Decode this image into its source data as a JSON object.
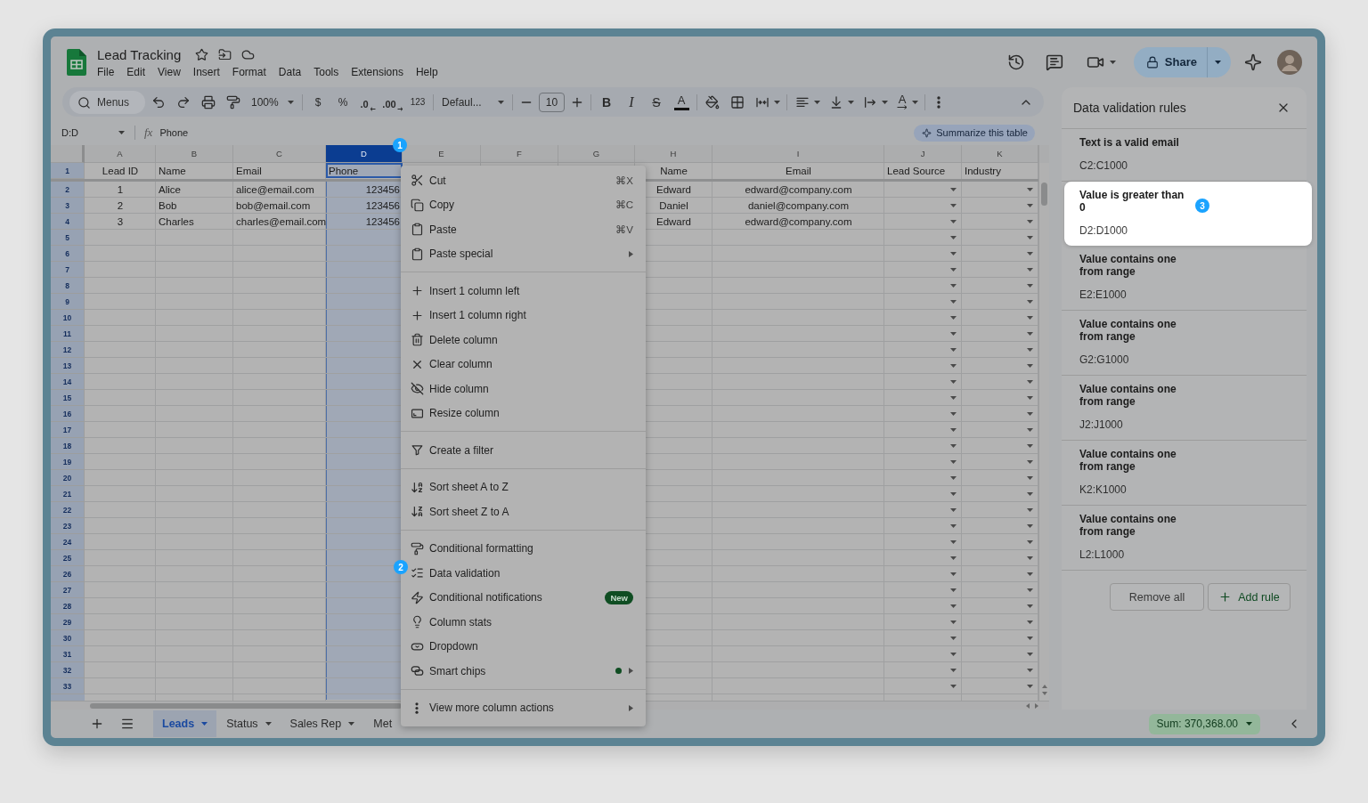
{
  "app": {
    "title": "Lead Tracking",
    "menus": [
      "File",
      "Edit",
      "View",
      "Insert",
      "Format",
      "Data",
      "Tools",
      "Extensions",
      "Help"
    ],
    "share": "Share"
  },
  "toolbar": [
    {
      "kind": "search",
      "placeholder": "Menus"
    },
    {
      "kind": "undo"
    },
    {
      "kind": "redo"
    },
    {
      "kind": "print"
    },
    {
      "kind": "paint_format"
    },
    {
      "kind": "zoom",
      "label": "100%"
    },
    {
      "kind": "divider"
    },
    {
      "kind": "currency",
      "label": "$"
    },
    {
      "kind": "percent",
      "label": "%"
    },
    {
      "kind": "decimal_less",
      "label": ".0"
    },
    {
      "kind": "decimal_more",
      "label": ".00"
    },
    {
      "kind": "number_format",
      "label": "123"
    },
    {
      "kind": "divider"
    },
    {
      "kind": "font",
      "label": "Defaul..."
    },
    {
      "kind": "divider"
    },
    {
      "kind": "minus"
    },
    {
      "kind": "field",
      "value": "10"
    },
    {
      "kind": "plus"
    },
    {
      "kind": "divider"
    },
    {
      "kind": "bold",
      "label": "B"
    },
    {
      "kind": "italic",
      "label": "I"
    },
    {
      "kind": "strike",
      "label": "S"
    },
    {
      "kind": "text_color",
      "label": "A"
    },
    {
      "kind": "divider"
    },
    {
      "kind": "fill"
    },
    {
      "kind": "borders"
    },
    {
      "kind": "merge"
    },
    {
      "kind": "divider"
    },
    {
      "kind": "align"
    },
    {
      "kind": "valign"
    },
    {
      "kind": "wrap"
    },
    {
      "kind": "rotate",
      "label": "A"
    },
    {
      "kind": "divider"
    },
    {
      "kind": "more"
    },
    {
      "kind": "collapse"
    }
  ],
  "formula_bar": {
    "name_box": "D:D",
    "fx": "fx",
    "formula": "Phone",
    "chip": "Summarize this table"
  },
  "grid": {
    "columns": [
      {
        "label": "A",
        "selected": false,
        "dropdown": false
      },
      {
        "label": "B",
        "selected": false,
        "dropdown": false
      },
      {
        "label": "C",
        "selected": false,
        "dropdown": false
      },
      {
        "label": "D",
        "selected": true,
        "dropdown": false,
        "callout": "1"
      },
      {
        "label": "E",
        "selected": false,
        "dropdown": false
      },
      {
        "label": "F",
        "selected": false,
        "dropdown": false
      },
      {
        "label": "G",
        "selected": false,
        "dropdown": false
      },
      {
        "label": "H",
        "selected": false,
        "dropdown": false
      },
      {
        "label": "I",
        "selected": false,
        "dropdown": false
      },
      {
        "label": "J",
        "selected": false,
        "dropdown": true
      },
      {
        "label": "K",
        "selected": false,
        "dropdown": true
      }
    ],
    "rows": [
      {
        "number": "1",
        "frozen": true,
        "cells": {
          "A": {
            "text": "Lead ID",
            "kind": "centered"
          },
          "B": {
            "text": "Name",
            "kind": "text"
          },
          "C": {
            "text": "Email",
            "kind": "text"
          },
          "D": {
            "text": "Phone",
            "kind": "text"
          },
          "H": {
            "text": "Name",
            "kind": "centered"
          },
          "I": {
            "text": "Email",
            "kind": "centered"
          },
          "J": {
            "text": "Lead Source",
            "kind": "text"
          },
          "K": {
            "text": "Industry",
            "kind": "text"
          }
        }
      },
      {
        "number": "2",
        "frozen": false,
        "cells": {
          "A": {
            "text": "1",
            "kind": "centered"
          },
          "B": {
            "text": "Alice",
            "kind": "text"
          },
          "C": {
            "text": "alice@email.com",
            "kind": "text"
          },
          "D": {
            "text": "123456",
            "kind": "number"
          },
          "H": {
            "text": "Edward",
            "kind": "centered"
          },
          "I": {
            "text": "edward@company.com",
            "kind": "centered"
          }
        }
      },
      {
        "number": "3",
        "frozen": false,
        "cells": {
          "A": {
            "text": "2",
            "kind": "centered"
          },
          "B": {
            "text": "Bob",
            "kind": "text"
          },
          "C": {
            "text": "bob@email.com",
            "kind": "text"
          },
          "D": {
            "text": "123456",
            "kind": "number"
          },
          "H": {
            "text": "Daniel",
            "kind": "centered"
          },
          "I": {
            "text": "daniel@company.com",
            "kind": "centered"
          }
        }
      },
      {
        "number": "4",
        "frozen": false,
        "cells": {
          "A": {
            "text": "3",
            "kind": "centered"
          },
          "B": {
            "text": "Charles",
            "kind": "text"
          },
          "C": {
            "text": "charles@email.com",
            "kind": "text"
          },
          "D": {
            "text": "123456",
            "kind": "number"
          },
          "H": {
            "text": "Edward",
            "kind": "centered"
          },
          "I": {
            "text": "edward@company.com",
            "kind": "centered"
          }
        }
      },
      {
        "number": "5",
        "frozen": false
      },
      {
        "number": "6",
        "frozen": false
      },
      {
        "number": "7",
        "frozen": false
      },
      {
        "number": "8",
        "frozen": false
      },
      {
        "number": "9",
        "frozen": false
      },
      {
        "number": "10",
        "frozen": false
      },
      {
        "number": "11",
        "frozen": false
      },
      {
        "number": "12",
        "frozen": false
      },
      {
        "number": "13",
        "frozen": false
      },
      {
        "number": "14",
        "frozen": false
      },
      {
        "number": "15",
        "frozen": false
      },
      {
        "number": "16",
        "frozen": false
      },
      {
        "number": "17",
        "frozen": false
      },
      {
        "number": "18",
        "frozen": false
      },
      {
        "number": "19",
        "frozen": false
      },
      {
        "number": "20",
        "frozen": false
      },
      {
        "number": "21",
        "frozen": false
      },
      {
        "number": "22",
        "frozen": false
      },
      {
        "number": "23",
        "frozen": false
      },
      {
        "number": "24",
        "frozen": false
      },
      {
        "number": "25",
        "frozen": false
      },
      {
        "number": "26",
        "frozen": false
      },
      {
        "number": "27",
        "frozen": false
      },
      {
        "number": "28",
        "frozen": false
      },
      {
        "number": "29",
        "frozen": false
      },
      {
        "number": "30",
        "frozen": false
      },
      {
        "number": "31",
        "frozen": false
      },
      {
        "number": "32",
        "frozen": false
      },
      {
        "number": "33",
        "frozen": false
      }
    ]
  },
  "context_menu": {
    "groups": [
      [
        {
          "kind": "cut",
          "label": "Cut",
          "shortcut": "⌘X",
          "submenu": false,
          "dot": false
        },
        {
          "kind": "copy",
          "label": "Copy",
          "shortcut": "⌘C",
          "submenu": false,
          "dot": false
        },
        {
          "kind": "paste",
          "label": "Paste",
          "shortcut": "⌘V",
          "submenu": false,
          "dot": false
        },
        {
          "kind": "paste_special",
          "label": "Paste special",
          "submenu": true,
          "dot": false
        }
      ],
      [
        {
          "kind": "insert_left",
          "label": "Insert 1 column left",
          "submenu": false,
          "dot": false
        },
        {
          "kind": "insert_right",
          "label": "Insert 1 column right",
          "submenu": false,
          "dot": false
        },
        {
          "kind": "delete",
          "label": "Delete column",
          "submenu": false,
          "dot": false
        },
        {
          "kind": "clear",
          "label": "Clear column",
          "submenu": false,
          "dot": false
        },
        {
          "kind": "hide",
          "label": "Hide column",
          "submenu": false,
          "dot": false
        },
        {
          "kind": "resize",
          "label": "Resize column",
          "submenu": false,
          "dot": false
        }
      ],
      [
        {
          "kind": "filter",
          "label": "Create a filter",
          "submenu": false,
          "dot": false
        }
      ],
      [
        {
          "kind": "sort_asc",
          "label": "Sort sheet A to Z",
          "submenu": false,
          "dot": false
        },
        {
          "kind": "sort_desc",
          "label": "Sort sheet Z to A",
          "submenu": false,
          "dot": false
        }
      ],
      [
        {
          "kind": "conditional_formatting",
          "label": "Conditional formatting",
          "submenu": false,
          "dot": false
        },
        {
          "kind": "data_validation",
          "label": "Data validation",
          "submenu": false,
          "dot": false,
          "callout": "2"
        },
        {
          "kind": "notifications",
          "label": "Conditional notifications",
          "badge": "New",
          "submenu": false,
          "dot": false
        },
        {
          "kind": "stats",
          "label": "Column stats",
          "submenu": false,
          "dot": false
        },
        {
          "kind": "dropdown",
          "label": "Dropdown",
          "submenu": false,
          "dot": false
        },
        {
          "kind": "smart_chips",
          "label": "Smart chips",
          "submenu": true,
          "dot": true
        }
      ],
      [
        {
          "kind": "more",
          "label": "View more column actions",
          "submenu": true,
          "dot": false
        }
      ]
    ]
  },
  "validation_panel": {
    "title": "Data validation rules",
    "rules": [
      {
        "condition": "Text is a valid email",
        "range": "C2:C1000",
        "selected": false
      },
      {
        "condition": "Value is greater than 0",
        "range": "D2:D1000",
        "selected": true,
        "callout": "3"
      },
      {
        "condition": "Value contains one from range",
        "range": "E2:E1000",
        "selected": false
      },
      {
        "condition": "Value contains one from range",
        "range": "G2:G1000",
        "selected": false
      },
      {
        "condition": "Value contains one from range",
        "range": "J2:J1000",
        "selected": false
      },
      {
        "condition": "Value contains one from range",
        "range": "K2:K1000",
        "selected": false
      },
      {
        "condition": "Value contains one from range",
        "range": "L2:L1000",
        "selected": false
      }
    ],
    "remove_all": "Remove all",
    "add_rule": "Add rule"
  },
  "sheet_bar": {
    "tabs": [
      {
        "label": "Leads",
        "selected": true,
        "dropdown": true
      },
      {
        "label": "Status",
        "selected": false,
        "dropdown": true
      },
      {
        "label": "Sales Rep",
        "selected": false,
        "dropdown": true
      },
      {
        "label": "Met",
        "selected": false,
        "dropdown": false
      }
    ],
    "sum": "Sum: 370,368.00"
  }
}
